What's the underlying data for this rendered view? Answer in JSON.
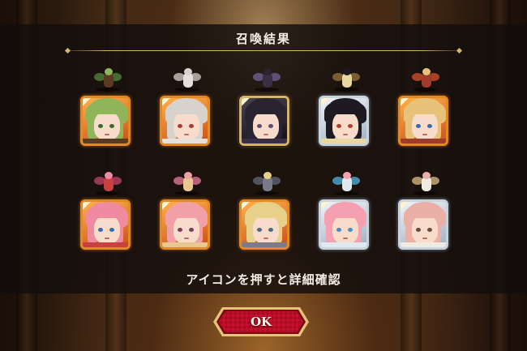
{
  "dialog": {
    "title": "召喚結果",
    "hint": "アイコンを押すと詳細確認",
    "ok_label": "OK"
  },
  "colors": {
    "frame_gold": "#e08a24",
    "frame_platinum": "#c9d3dc",
    "frame_black": "#d6b36a",
    "button_red": "#c8102e",
    "title_line": "#d9b56a"
  },
  "results": [
    {
      "icon": "green-hair-girl-portrait",
      "rarity": "gold",
      "hair": "#8fb55a",
      "eyes": "#3b6b2a",
      "outfit": "#5a3a22",
      "sprite": "#4d7a3a"
    },
    {
      "icon": "silver-hair-girl-portrait",
      "rarity": "gold",
      "hair": "#d8d2cc",
      "eyes": "#a0402e",
      "outfit": "#e6e0dc",
      "sprite": "#c0b8b0"
    },
    {
      "icon": "black-hair-girl-portrait",
      "rarity": "black",
      "hair": "#2a2430",
      "eyes": "#5a4a78",
      "outfit": "#3a2e44",
      "sprite": "#6a5a88"
    },
    {
      "icon": "short-black-hair-girl-portrait",
      "rarity": "platinum",
      "hair": "#1e1a22",
      "eyes": "#b0402a",
      "outfit": "#e8d8a0",
      "sprite": "#8a6a3a"
    },
    {
      "icon": "blonde-girl-portrait",
      "rarity": "gold",
      "hair": "#e8c27a",
      "eyes": "#3a6ab0",
      "outfit": "#a03a2a",
      "sprite": "#c04a2a"
    },
    {
      "icon": "pink-hair-girl-portrait",
      "rarity": "gold",
      "hair": "#f08aa0",
      "eyes": "#3a6ab0",
      "outfit": "#c84040",
      "sprite": "#b04060"
    },
    {
      "icon": "pink-hair-girl-2-portrait",
      "rarity": "gold",
      "hair": "#f2a0a8",
      "eyes": "#7a3a5a",
      "outfit": "#e8c890",
      "sprite": "#d07090"
    },
    {
      "icon": "blonde-knight-portrait",
      "rarity": "gold",
      "hair": "#e6d08a",
      "eyes": "#4a6a80",
      "outfit": "#7a7a88",
      "sprite": "#5a6070"
    },
    {
      "icon": "pink-hair-maid-portrait",
      "rarity": "platinum",
      "hair": "#f4a0b0",
      "eyes": "#4a8ac0",
      "outfit": "#e0e8f0",
      "sprite": "#4aa0c8"
    },
    {
      "icon": "strawberry-blonde-girl-portrait",
      "rarity": "platinum",
      "hair": "#eab0a8",
      "eyes": "#6a4a3a",
      "outfit": "#f0eae0",
      "sprite": "#c8a878"
    }
  ]
}
